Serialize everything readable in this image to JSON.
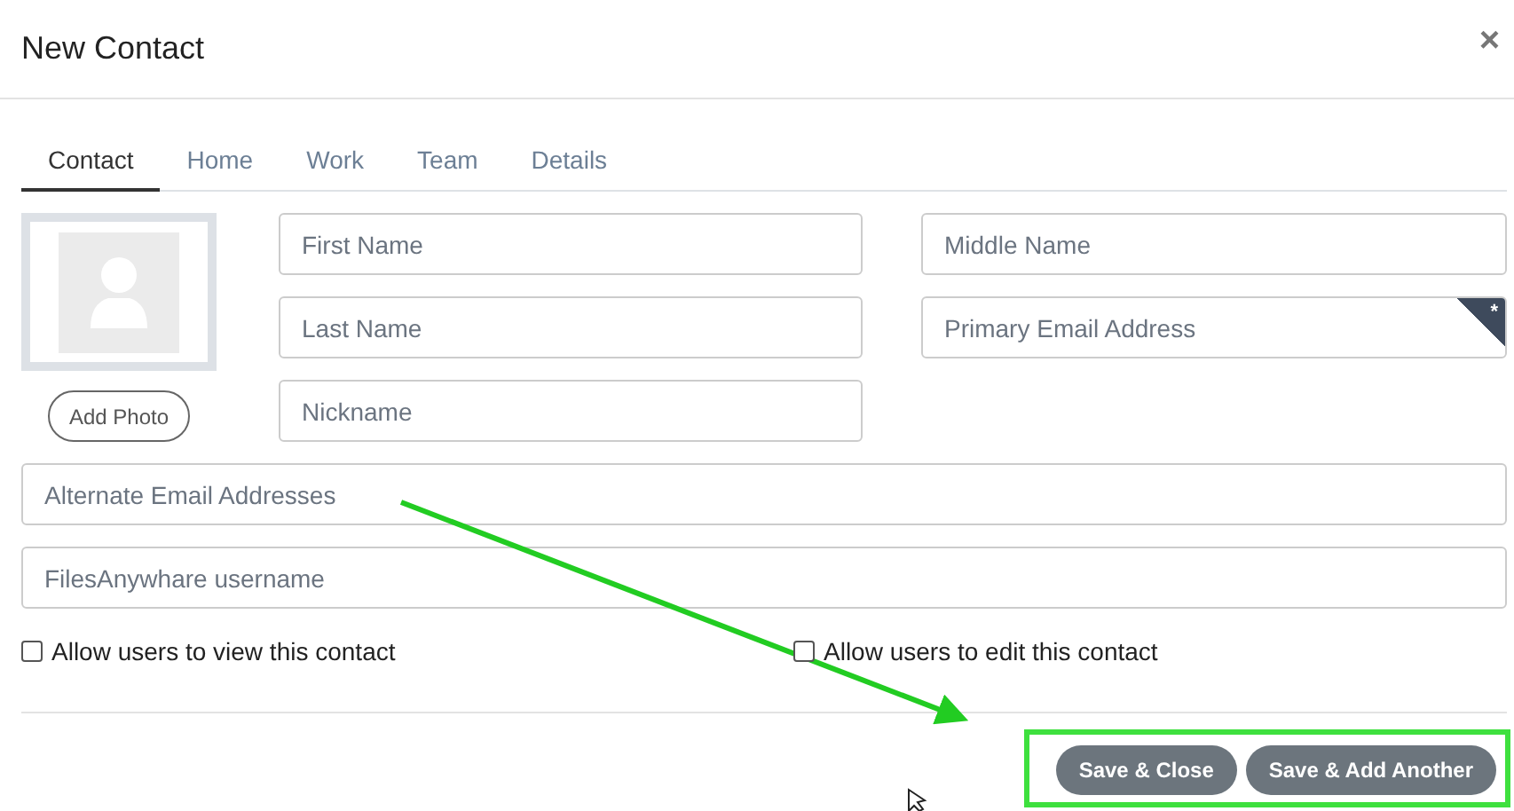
{
  "dialog": {
    "title": "New Contact",
    "close": "×"
  },
  "tabs": [
    {
      "label": "Contact",
      "selected": true
    },
    {
      "label": "Home",
      "selected": false
    },
    {
      "label": "Work",
      "selected": false
    },
    {
      "label": "Team",
      "selected": false
    },
    {
      "label": "Details",
      "selected": false
    }
  ],
  "photo": {
    "button": "Add Photo"
  },
  "name_rows": [
    [
      {
        "placeholder": "First Name"
      },
      {
        "placeholder": "Middle Name"
      }
    ],
    [
      {
        "placeholder": "Last Name"
      },
      {
        "placeholder": "Primary Email Address",
        "corner_mark": "*"
      }
    ],
    [
      {
        "placeholder": "Nickname"
      }
    ]
  ],
  "wide_fields": [
    {
      "placeholder": "Alternate Email Addresses"
    },
    {
      "placeholder": "FilesAnywhare username"
    }
  ],
  "checkboxes": [
    {
      "label": "Allow users to view this contact",
      "checked": false
    },
    {
      "label": "Allow users to edit this contact",
      "checked": false
    }
  ],
  "buttons": [
    "Save & Close",
    "Save & Add Another"
  ]
}
